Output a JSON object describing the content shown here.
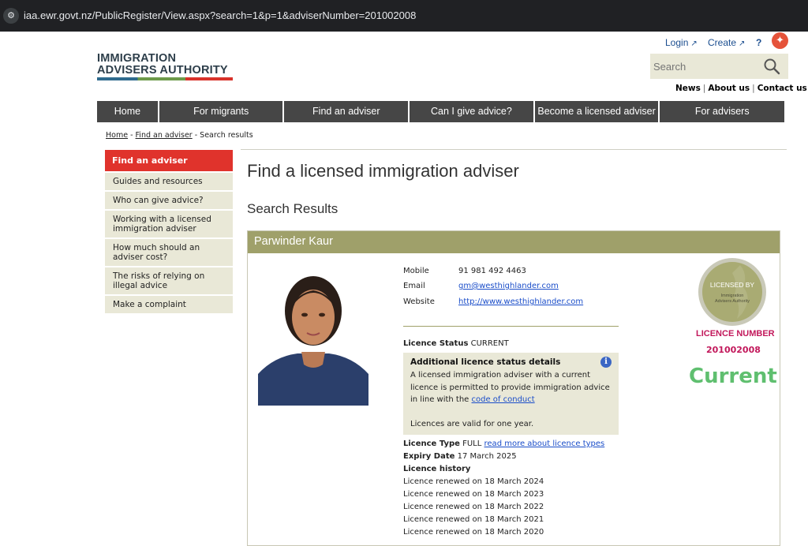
{
  "browser": {
    "url": "iaa.ewr.govt.nz/PublicRegister/View.aspx?search=1&p=1&adviserNumber=201002008"
  },
  "header": {
    "logo_line1": "IMMIGRATION",
    "logo_line2": "ADVISERS AUTHORITY",
    "login_label": "Login",
    "create_label": "Create",
    "help_label": "?",
    "search": {
      "placeholder": "Search",
      "value": ""
    },
    "secondary_links": [
      "News",
      "About us",
      "Contact us"
    ]
  },
  "nav": {
    "items": [
      "Home",
      "For migrants",
      "Find an adviser",
      "Can I give advice?",
      "Become a licensed adviser",
      "For advisers"
    ]
  },
  "breadcrumb": {
    "home": "Home",
    "separator": " - ",
    "find": "Find an adviser",
    "current": "Search results"
  },
  "sidebar": {
    "active": "Find an adviser",
    "items": [
      "Guides and resources",
      "Who can give advice?",
      "Working with a licensed immigration adviser",
      "How much should an adviser cost?",
      "The risks of relying on illegal advice",
      "Make a complaint"
    ]
  },
  "main": {
    "title": "Find a licensed immigration adviser",
    "results_heading": "Search Results"
  },
  "adviser": {
    "name": "Parwinder Kaur",
    "contact": {
      "mobile_label": "Mobile",
      "mobile": "91 981 492 4463",
      "email_label": "Email",
      "email": "gm@westhighlander.com",
      "website_label": "Website",
      "website": "http://www.westhighlander.com"
    },
    "status_label": "Licence Status",
    "status_value": "CURRENT",
    "status_box": {
      "title": "Additional licence status details",
      "text_prefix": "A licensed immigration adviser with a current licence is permitted to provide immigration advice in line with the ",
      "link_text": "code of conduct",
      "note": "Licences are valid for one year."
    },
    "licence_type_label": "Licence Type",
    "licence_type_value": "FULL",
    "licence_type_link": "read more about licence types",
    "expiry_label": "Expiry Date",
    "expiry_value": "17 March 2025",
    "history_label": "Licence history",
    "history": [
      "Licence renewed on 18 March 2024",
      "Licence renewed on 18 March 2023",
      "Licence renewed on 18 March 2022",
      "Licence renewed on 18 March 2021",
      "Licence renewed on 18 March 2020"
    ],
    "seal": {
      "line1": "LICENSED BY",
      "line2": "Immigration",
      "line3": "Advisers Authority"
    },
    "licence_number_label": "LICENCE NUMBER",
    "licence_number": "201002008",
    "current_badge": "Current"
  },
  "colors": {
    "nav_bg": "#464646",
    "accent_red": "#e0332c",
    "card_header": "#9fa06a",
    "panel_bg": "#e9e8d7",
    "link": "#1a4dc9",
    "licence_number": "#c2185b",
    "current_green": "#5fbf6f"
  },
  "icons": {
    "site_info": "tune-icon",
    "external": "external-link-icon",
    "search": "search-icon",
    "info": "info-icon",
    "brand": "brave-icon"
  }
}
